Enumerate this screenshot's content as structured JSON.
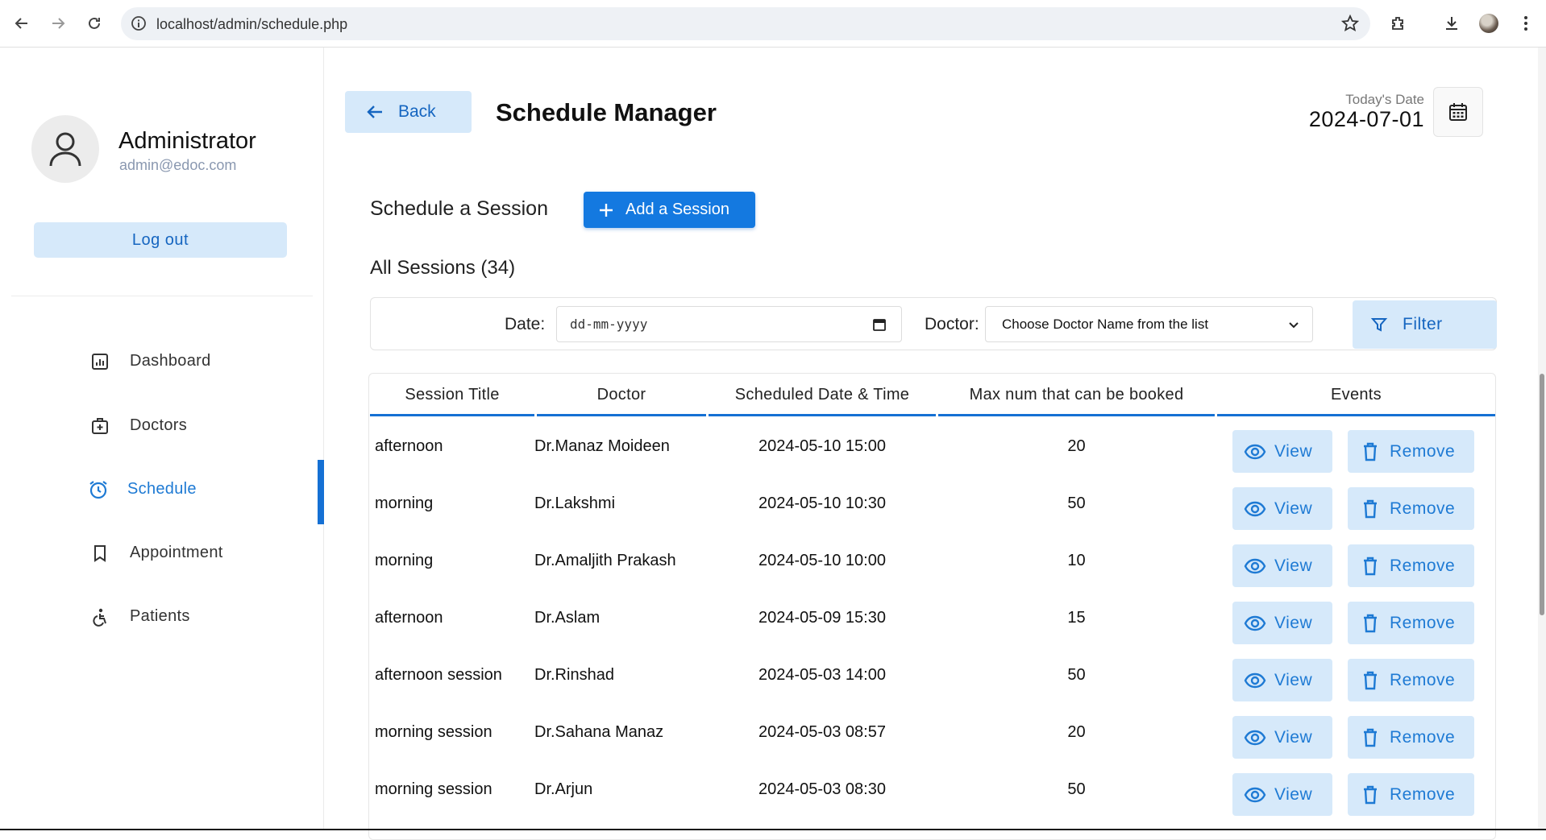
{
  "browser": {
    "url": "localhost/admin/schedule.php"
  },
  "sidebar": {
    "profile_name": "Administrator",
    "profile_email": "admin@edoc.com",
    "logout_label": "Log out",
    "items": [
      {
        "label": "Dashboard",
        "icon": "dashboard-icon"
      },
      {
        "label": "Doctors",
        "icon": "doctors-icon"
      },
      {
        "label": "Schedule",
        "icon": "schedule-icon",
        "active": true
      },
      {
        "label": "Appointment",
        "icon": "bookmark-icon"
      },
      {
        "label": "Patients",
        "icon": "patients-icon"
      }
    ]
  },
  "header": {
    "back_label": "Back",
    "title": "Schedule Manager",
    "today_label": "Today's Date",
    "today_value": "2024-07-01"
  },
  "main": {
    "schedule_label": "Schedule a Session",
    "add_label": "Add a Session",
    "all_sessions_label": "All Sessions (34)",
    "filter": {
      "date_label": "Date:",
      "date_placeholder": "dd-mm-yyyy",
      "doctor_label": "Doctor:",
      "doctor_select_value": "Choose Doctor Name from the list",
      "filter_label": "Filter"
    }
  },
  "table": {
    "headers": [
      "Session Title",
      "Doctor",
      "Scheduled Date & Time",
      "Max num that can be booked",
      "Events"
    ],
    "view_label": "View",
    "remove_label": "Remove",
    "rows": [
      {
        "title": "afternoon",
        "doctor": "Dr.Manaz Moideen",
        "datetime": "2024-05-10 15:00",
        "max": "20"
      },
      {
        "title": "morning",
        "doctor": "Dr.Lakshmi",
        "datetime": "2024-05-10 10:30",
        "max": "50"
      },
      {
        "title": "morning",
        "doctor": "Dr.Amaljith Prakash",
        "datetime": "2024-05-10 10:00",
        "max": "10"
      },
      {
        "title": "afternoon",
        "doctor": "Dr.Aslam",
        "datetime": "2024-05-09 15:30",
        "max": "15"
      },
      {
        "title": "afternoon session",
        "doctor": "Dr.Rinshad",
        "datetime": "2024-05-03 14:00",
        "max": "50"
      },
      {
        "title": "morning session",
        "doctor": "Dr.Sahana Manaz",
        "datetime": "2024-05-03 08:57",
        "max": "20"
      },
      {
        "title": "morning session",
        "doctor": "Dr.Arjun",
        "datetime": "2024-05-03 08:30",
        "max": "50"
      }
    ]
  },
  "colors": {
    "accent": "#1479e0",
    "accent_light": "#d6e9fa",
    "accent_text": "#1e7ad4"
  }
}
